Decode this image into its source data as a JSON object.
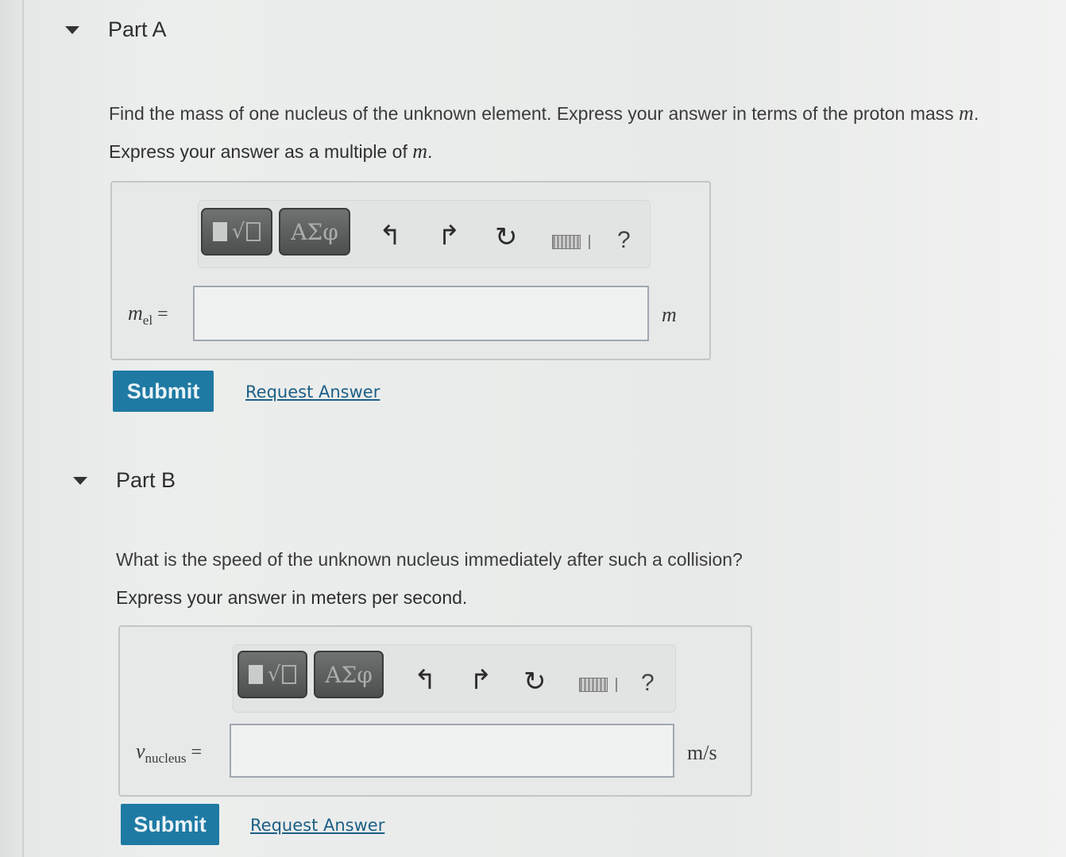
{
  "part_a": {
    "title": "Part A",
    "prompt_text": "Find the mass of one nucleus of the unknown element. Express your answer in terms of the proton mass ",
    "prompt_var": "m",
    "prompt_end": ".",
    "instruction_text": "Express your answer as a multiple of ",
    "instruction_var": "m",
    "instruction_end": ".",
    "toolbar": {
      "greek_label": "ΑΣφ",
      "help_label": "?"
    },
    "input": {
      "var": "m",
      "sub": "el",
      "equals": "=",
      "value": ""
    },
    "unit": "m",
    "submit_label": "Submit",
    "request_label": "Request Answer"
  },
  "part_b": {
    "title": "Part B",
    "prompt_text": "What is the speed of the unknown nucleus immediately after such a collision?",
    "instruction_text": "Express your answer in meters per second.",
    "toolbar": {
      "greek_label": "ΑΣφ",
      "help_label": "?"
    },
    "input": {
      "var": "v",
      "sub": "nucleus",
      "equals": "=",
      "value": ""
    },
    "unit": "m/s",
    "submit_label": "Submit",
    "request_label": "Request Answer"
  },
  "icons": [
    "caret-down-icon",
    "template-icon",
    "undo-icon",
    "redo-icon",
    "reset-icon",
    "keyboard-icon",
    "help-icon"
  ]
}
